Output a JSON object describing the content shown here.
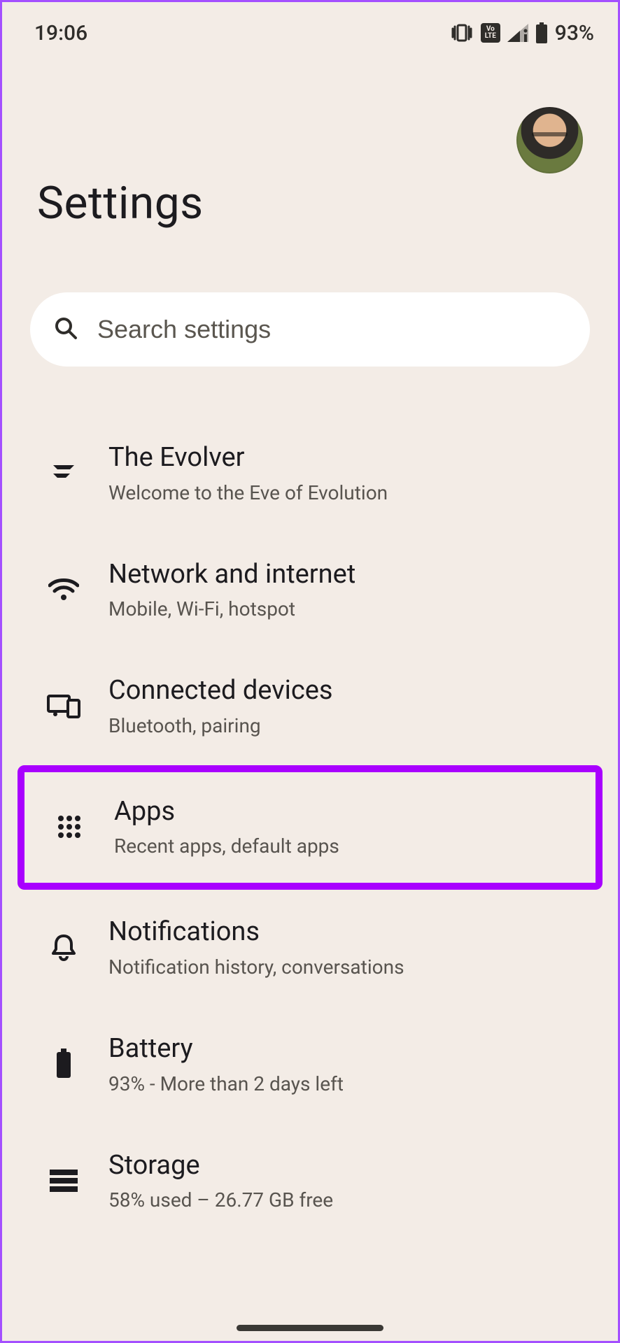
{
  "status": {
    "time": "19:06",
    "battery": "93%"
  },
  "header": {
    "title": "Settings"
  },
  "search": {
    "placeholder": "Search settings"
  },
  "items": [
    {
      "id": "evolver",
      "title": "The Evolver",
      "subtitle": "Welcome to the Eve of Evolution",
      "highlight": false
    },
    {
      "id": "network",
      "title": "Network and internet",
      "subtitle": "Mobile, Wi-Fi, hotspot",
      "highlight": false
    },
    {
      "id": "connected",
      "title": "Connected devices",
      "subtitle": "Bluetooth, pairing",
      "highlight": false
    },
    {
      "id": "apps",
      "title": "Apps",
      "subtitle": "Recent apps, default apps",
      "highlight": true
    },
    {
      "id": "notif",
      "title": "Notifications",
      "subtitle": "Notification history, conversations",
      "highlight": false
    },
    {
      "id": "battery",
      "title": "Battery",
      "subtitle": "93% - More than 2 days left",
      "highlight": false
    },
    {
      "id": "storage",
      "title": "Storage",
      "subtitle": "58% used – 26.77 GB free",
      "highlight": false
    }
  ]
}
